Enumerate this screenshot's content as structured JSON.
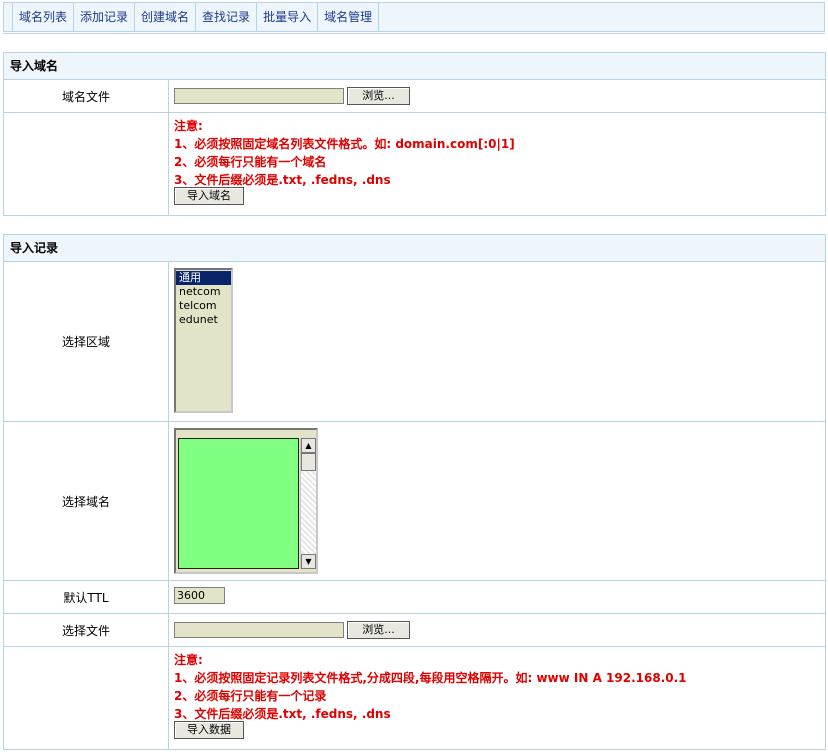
{
  "tabs": [
    {
      "label": "域名列表"
    },
    {
      "label": "添加记录"
    },
    {
      "label": "创建域名"
    },
    {
      "label": "查找记录"
    },
    {
      "label": "批量导入"
    },
    {
      "label": "域名管理"
    }
  ],
  "import_domain": {
    "title": "导入域名",
    "file_label": "域名文件",
    "browse_label": "浏览...",
    "notes": [
      "注意:",
      "1、必须按照固定域名列表文件格式。如:   domain.com[:0|1]",
      "2、必须每行只能有一个域名",
      "3、文件后缀必须是.txt, .fedns, .dns"
    ],
    "submit_label": "导入域名"
  },
  "import_record": {
    "title": "导入记录",
    "region_label": "选择区域",
    "region_options": [
      "通用",
      "netcom",
      "telcom",
      "edunet"
    ],
    "region_selected": "通用",
    "domain_label": "选择域名",
    "ttl_label": "默认TTL",
    "ttl_value": "3600",
    "file_label": "选择文件",
    "browse_label": "浏览...",
    "notes": [
      "注意:",
      "1、必须按照固定记录列表文件格式,分成四段,每段用空格隔开。如:   www IN A 192.168.0.1",
      "2、必须每行只能有一个记录",
      "3、文件后缀必须是.txt, .fedns, .dns"
    ],
    "submit_label": "导入数据"
  },
  "icons": {
    "scroll_up": "arrow-up-icon",
    "scroll_down": "arrow-down-icon"
  },
  "colors": {
    "notes_text": "#e00000",
    "domain_list_bg": "#80ff80",
    "field_bg": "#e3e3c8",
    "header_bg": "#eef5fb",
    "border": "#b7d3e8",
    "tab_text": "#1a3b8f",
    "selected_option_bg": "#0a246a"
  }
}
